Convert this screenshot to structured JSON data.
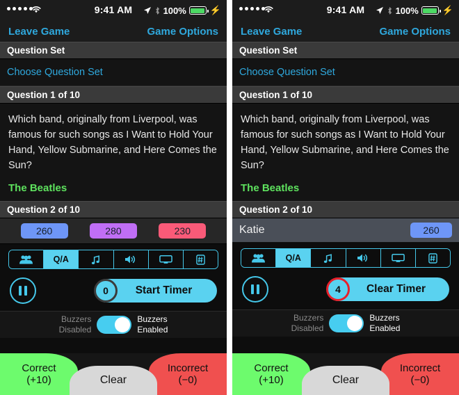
{
  "colors": {
    "accent_cyan": "#45c8ea",
    "link_blue": "#2fa8dd",
    "answer_green": "#5ee25e",
    "badge_blue": "#6e96f7",
    "badge_purple": "#c06ef5",
    "badge_pink": "#fa5a78",
    "correct_green": "#6dfb6d",
    "incorrect_red": "#f0504f",
    "clear_grey": "#d8d8d8",
    "timer_active_ring": "#e8202a"
  },
  "status_bar": {
    "carrier_dots": 5,
    "wifi_icon": "wifi-icon",
    "time": "9:41 AM",
    "location_icon": "location-arrow-icon",
    "bluetooth_icon": "bluetooth-icon",
    "battery_percent": "100%",
    "charging_icon": "lightning-bolt-icon"
  },
  "navbar": {
    "leave": "Leave Game",
    "options": "Game Options"
  },
  "sections": {
    "question_set_header": "Question Set",
    "choose_question_set": "Choose Question Set",
    "question_1_header": "Question 1 of 10",
    "question_text": "Which band, originally from Liverpool, was famous for such songs as I Want to Hold Your Hand, Yellow Submarine, and Here Comes the Sun?",
    "answer_text": "The Beatles",
    "question_2_header": "Question 2 of 10"
  },
  "left_panel": {
    "scores": [
      {
        "value": "260",
        "color": "#6e96f7"
      },
      {
        "value": "280",
        "color": "#c06ef5"
      },
      {
        "value": "230",
        "color": "#fa5a78"
      }
    ],
    "timer": {
      "count": "0",
      "label": "Start Timer",
      "ring_active": false
    }
  },
  "right_panel": {
    "player": {
      "name": "Katie",
      "score": "260",
      "score_color": "#6e96f7"
    },
    "timer": {
      "count": "4",
      "label": "Clear Timer",
      "ring_active": true
    }
  },
  "segmented": {
    "items": [
      {
        "icon": "team-people-icon",
        "label": "",
        "selected": false
      },
      {
        "icon": "qa-icon",
        "label": "Q/A",
        "selected": true
      },
      {
        "icon": "music-note-icon",
        "label": "",
        "selected": false
      },
      {
        "icon": "speaker-volume-icon",
        "label": "",
        "selected": false
      },
      {
        "icon": "tv-monitor-icon",
        "label": "",
        "selected": false
      },
      {
        "icon": "number-pad-icon",
        "label": "",
        "selected": false
      }
    ]
  },
  "buzzers": {
    "disabled_line1": "Buzzers",
    "disabled_line2": "Disabled",
    "enabled_line1": "Buzzers",
    "enabled_line2": "Enabled",
    "state_on": true
  },
  "actions": {
    "correct_line1": "Correct",
    "correct_line2": "(+10)",
    "clear_label": "Clear",
    "incorrect_line1": "Incorrect",
    "incorrect_line2": "(−0)"
  },
  "pause_icon": "pause-icon"
}
